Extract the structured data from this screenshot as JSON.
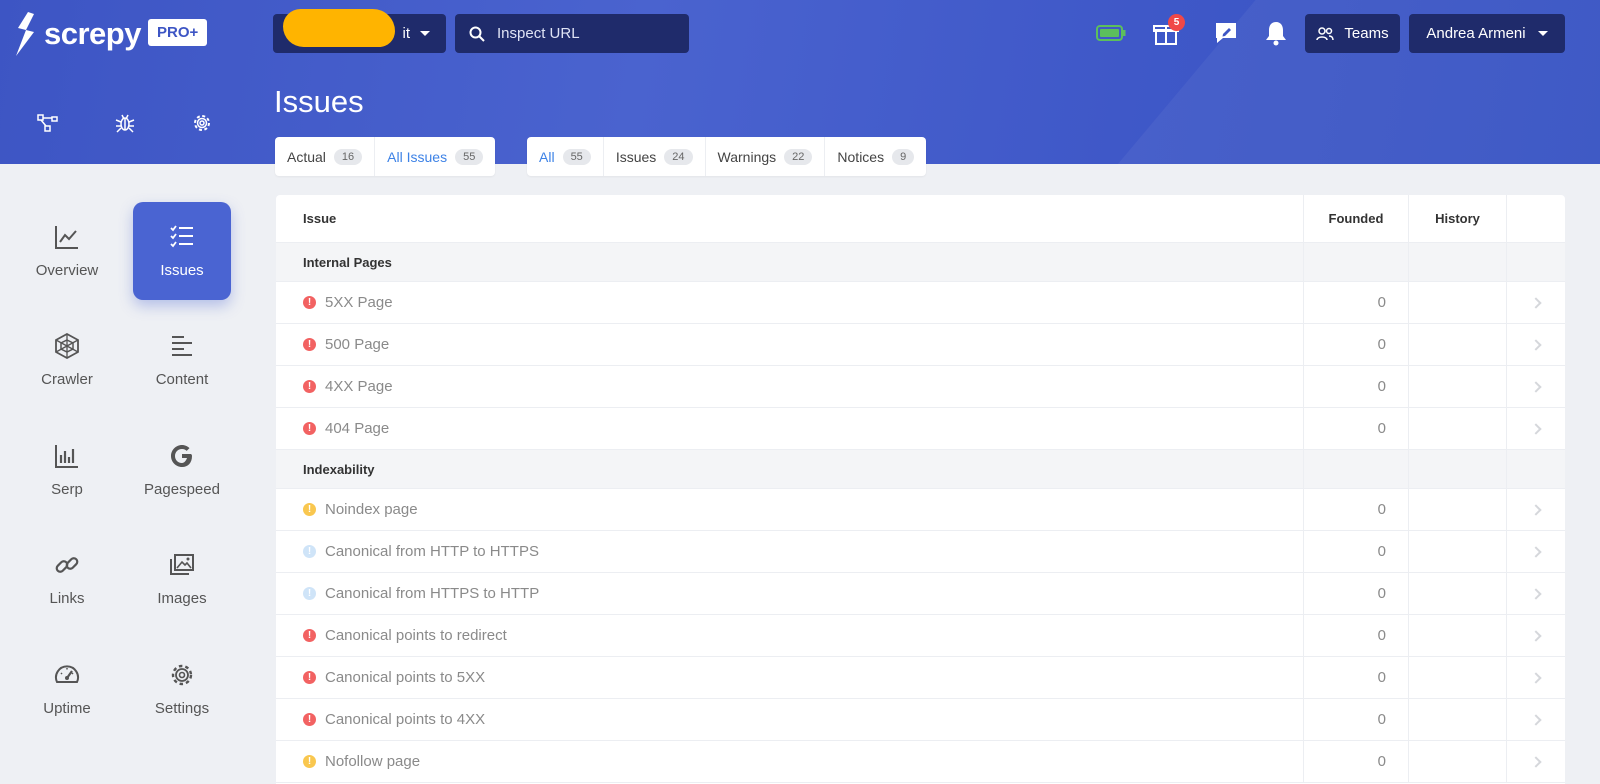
{
  "header": {
    "logo_text": "screpy",
    "plan_badge": "PRO+",
    "project_name_visible": "it",
    "search": {
      "placeholder": "Inspect URL"
    },
    "gift_badge_count": "5",
    "teams_label": "Teams",
    "user_name": "Andrea Armeni"
  },
  "page": {
    "title": "Issues"
  },
  "filter_tabs_left": [
    {
      "label": "Actual",
      "count": "16",
      "active": false
    },
    {
      "label": "All Issues",
      "count": "55",
      "active": true
    }
  ],
  "filter_tabs_right": [
    {
      "label": "All",
      "count": "55",
      "active": true
    },
    {
      "label": "Issues",
      "count": "24",
      "active": false
    },
    {
      "label": "Warnings",
      "count": "22",
      "active": false
    },
    {
      "label": "Notices",
      "count": "9",
      "active": false
    }
  ],
  "sidebar": {
    "items": [
      {
        "label": "Overview",
        "icon": "chart-line-icon",
        "active": false
      },
      {
        "label": "Issues",
        "icon": "checklist-icon",
        "active": true
      },
      {
        "label": "Crawler",
        "icon": "spiderweb-icon",
        "active": false
      },
      {
        "label": "Content",
        "icon": "text-lines-icon",
        "active": false
      },
      {
        "label": "Serp",
        "icon": "bar-chart-icon",
        "active": false
      },
      {
        "label": "Pagespeed",
        "icon": "google-icon",
        "active": false
      },
      {
        "label": "Links",
        "icon": "link-icon",
        "active": false
      },
      {
        "label": "Images",
        "icon": "images-icon",
        "active": false
      },
      {
        "label": "Uptime",
        "icon": "speedometer-icon",
        "active": false
      },
      {
        "label": "Settings",
        "icon": "gear-icon",
        "active": false
      }
    ]
  },
  "table": {
    "columns": {
      "issue": "Issue",
      "founded": "Founded",
      "history": "History"
    },
    "groups": [
      {
        "name": "Internal Pages",
        "rows": [
          {
            "label": "5XX Page",
            "severity": "error",
            "founded": "0"
          },
          {
            "label": "500 Page",
            "severity": "error",
            "founded": "0"
          },
          {
            "label": "4XX Page",
            "severity": "error",
            "founded": "0"
          },
          {
            "label": "404 Page",
            "severity": "error",
            "founded": "0"
          }
        ]
      },
      {
        "name": "Indexability",
        "rows": [
          {
            "label": "Noindex page",
            "severity": "warning",
            "founded": "0"
          },
          {
            "label": "Canonical from HTTP to HTTPS",
            "severity": "notice",
            "founded": "0"
          },
          {
            "label": "Canonical from HTTPS to HTTP",
            "severity": "notice",
            "founded": "0"
          },
          {
            "label": "Canonical points to redirect",
            "severity": "error",
            "founded": "0"
          },
          {
            "label": "Canonical points to 5XX",
            "severity": "error",
            "founded": "0"
          },
          {
            "label": "Canonical points to 4XX",
            "severity": "error",
            "founded": "0"
          },
          {
            "label": "Nofollow page",
            "severity": "warning",
            "founded": "0"
          }
        ]
      }
    ]
  },
  "colors": {
    "brand": "#3d55c4",
    "dark_button": "#1f2b6b",
    "active_tab": "#3d82e6",
    "error": "#f26262",
    "warning": "#f9c74f",
    "notice": "#cfe4f8"
  }
}
